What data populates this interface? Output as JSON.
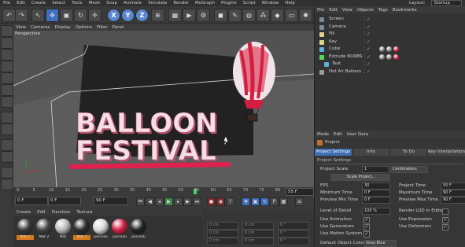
{
  "menubar": {
    "items": [
      "File",
      "Edit",
      "Create",
      "Select",
      "Tools",
      "Mesh",
      "Snap",
      "Animate",
      "Simulate",
      "Render",
      "MoGraph",
      "Plugins",
      "Script",
      "Window",
      "Help"
    ],
    "layout_label": "Layout:",
    "layout_value": "Startup"
  },
  "toolbar": {
    "xyz": [
      "X",
      "Y",
      "Z"
    ]
  },
  "viewport": {
    "menu": [
      "View",
      "Cameras",
      "Display",
      "Options",
      "Filter",
      "Panel"
    ],
    "label": "Perspective",
    "title_line1": "BALLOON",
    "title_line2": "FESTIVAL",
    "colors": {
      "text_face": "#f4dfe6",
      "text_side": "#b2506e",
      "bar": "#e2204e",
      "balloon_red": "#d51e3f",
      "wall": "#222222",
      "floor": "#5c5c5c"
    }
  },
  "timeline": {
    "ticks": [
      "0",
      "5",
      "10",
      "15",
      "20",
      "25",
      "30",
      "35",
      "40",
      "45",
      "50",
      "55",
      "60",
      "65",
      "70",
      "75",
      "80",
      "85",
      "90"
    ],
    "current_frame_field": "55 F",
    "start_field": "0 F",
    "min_field": "0 F",
    "max_field": "90 F",
    "end_field": "90 F",
    "current_frame_value": 55
  },
  "materials": {
    "menu": [
      "Create",
      "Edit",
      "Function",
      "Texture"
    ],
    "items": [
      {
        "label": "Mat 1",
        "color": "#3a3a3a"
      },
      {
        "label": "Mat 2",
        "color": "#444444"
      },
      {
        "label": "Mat",
        "color": "#b8b8b8"
      },
      {
        "label": "Mat 1",
        "color": "#2d2d2d"
      },
      {
        "label": "porcelai",
        "color": "#d8d8d8"
      },
      {
        "label": "porcelai",
        "color": "#d22045"
      },
      {
        "label": "porcelai",
        "color": "#222222"
      }
    ]
  },
  "coordinates": {
    "values": [
      "0 cm",
      "0 cm",
      "0 °",
      "0 cm",
      "0 cm",
      "0 °",
      "0 cm",
      "0 cm",
      "0 °"
    ]
  },
  "objects": {
    "menu": [
      "File",
      "Edit",
      "View",
      "Objects",
      "Tags",
      "Bookmarks"
    ],
    "rows": [
      {
        "name": "Screen",
        "color": "#7c8b99"
      },
      {
        "name": "Camera",
        "color": "#7c8b99"
      },
      {
        "name": "Fill",
        "color": "#dfd28a"
      },
      {
        "name": "Key",
        "color": "#dfd28a"
      },
      {
        "name": "Cube",
        "color": "#5bb0d8"
      },
      {
        "name": "Extrude NURBS",
        "color": "#5bd85b"
      },
      {
        "name": "Text",
        "color": "#5bb0d8"
      },
      {
        "name": "Hot Air Balloon",
        "color": "#9a9a9a"
      }
    ]
  },
  "attributes": {
    "menu": [
      "Mode",
      "Edit",
      "User Data"
    ],
    "object_label": "Project",
    "tabs": [
      "Project Settings",
      "Info",
      "To Do",
      "Key Interpolation"
    ],
    "section": "Project Settings",
    "project_scale_label": "Project Scale",
    "project_scale_value": "1",
    "project_scale_unit": "Centimeters",
    "scale_project_button": "Scale Project...",
    "fps_label": "FPS",
    "fps_value": "30",
    "project_time_label": "Project Time",
    "project_time_value": "55 F",
    "min_time_label": "Minimum Time",
    "min_time_value": "0 F",
    "max_time_label": "Maximum Time",
    "max_time_value": "90 F",
    "preview_min_label": "Preview Min Time",
    "preview_min_value": "0 F",
    "preview_max_label": "Preview Max Time",
    "preview_max_value": "90 F",
    "lod_label": "Level of Detail",
    "lod_value": "100 %",
    "render_lod_label": "Render LOD in Editor",
    "use_animation_label": "Use Animation",
    "use_expression_label": "Use Expression",
    "use_generators_label": "Use Generators",
    "use_deformers_label": "Use Deformers",
    "use_motion_label": "Use Motion System",
    "default_color_label": "Default Object Color",
    "default_color_value": "Gray-Blue"
  }
}
